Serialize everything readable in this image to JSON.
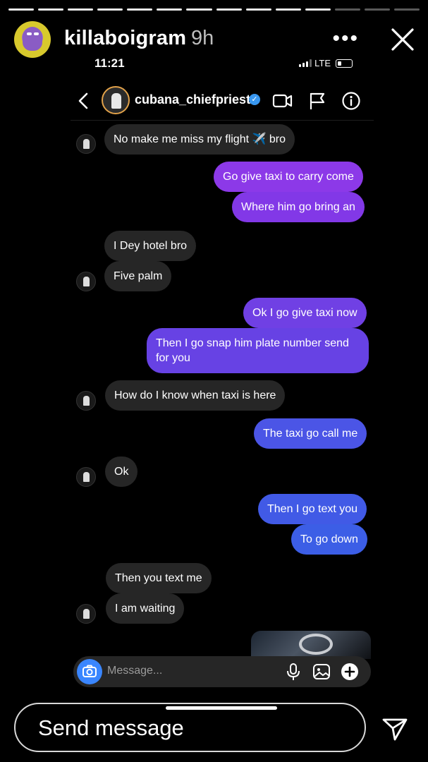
{
  "story": {
    "username": "killaboigram",
    "time_ago": "9h",
    "more_icon": "more-dots-icon",
    "close_icon": "close-icon",
    "progress_total": 14,
    "progress_done": 11
  },
  "device": {
    "time": "11:21",
    "network": "LTE"
  },
  "dm": {
    "contact": "cubana_chiefpriest",
    "verified_mark": "✓",
    "icons": [
      "back-chevron-icon",
      "video-call-icon",
      "flag-icon",
      "info-icon"
    ],
    "composer_placeholder": "Message..."
  },
  "messages": [
    {
      "from": "them",
      "text": "No make me miss my flight ✈️ bro"
    },
    {
      "from": "me",
      "text": "Go give taxi to carry come"
    },
    {
      "from": "me",
      "text": "Where him go bring an"
    },
    {
      "from": "them",
      "text": "I Dey hotel bro"
    },
    {
      "from": "them",
      "text": "Five palm"
    },
    {
      "from": "me",
      "text": "Ok I go give taxi now"
    },
    {
      "from": "me",
      "line1": "Then I go snap him plate number send",
      "line2": "for you"
    },
    {
      "from": "them",
      "text": "How do I know when taxi is here"
    },
    {
      "from": "me",
      "text": "The taxi go call me"
    },
    {
      "from": "them",
      "text": "Ok"
    },
    {
      "from": "me",
      "text": "Then I go text you"
    },
    {
      "from": "me",
      "text": "To go down"
    },
    {
      "from": "them",
      "text": "Then you text me"
    },
    {
      "from": "them",
      "text": "I am waiting"
    }
  ],
  "reply": {
    "placeholder": "Send message"
  },
  "colors": {
    "incoming": "#262626",
    "outgoing_top": "#8c39e8",
    "outgoing_mid": "#6a3fe3",
    "outgoing_bottom": "#3c5ee6",
    "camera": "#3a86ff"
  }
}
